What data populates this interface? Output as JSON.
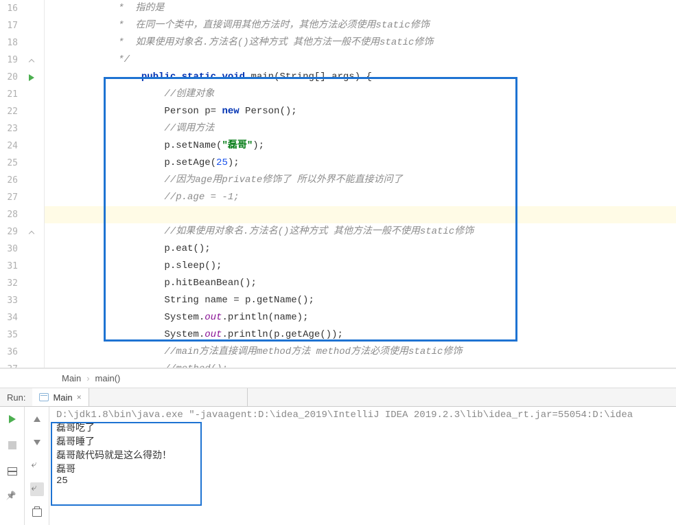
{
  "lines": [
    {
      "n": 16,
      "ind": 2,
      "type": "comment",
      "text": "*  指的是"
    },
    {
      "n": 17,
      "ind": 2,
      "type": "comment",
      "text": "*  在同一个类中，直接调用其他方法时，其他方法必须使用static修饰"
    },
    {
      "n": 18,
      "ind": 2,
      "type": "comment",
      "text": "*  如果使用对象名.方法名()这种方式 其他方法一般不使用static修饰"
    },
    {
      "n": 19,
      "ind": 2,
      "type": "comment",
      "text": "*/",
      "fold": "up"
    },
    {
      "n": 20,
      "ind": 3,
      "type": "main",
      "run": true,
      "fold": "down",
      "parts": [
        {
          "t": "public ",
          "c": "kw"
        },
        {
          "t": "static ",
          "c": "kw"
        },
        {
          "t": "void ",
          "c": "kw"
        },
        {
          "t": "main(String[] args) {"
        }
      ]
    },
    {
      "n": 21,
      "ind": 4,
      "type": "comment",
      "text": "//创建对象"
    },
    {
      "n": 22,
      "ind": 4,
      "type": "code",
      "parts": [
        {
          "t": "Person p= "
        },
        {
          "t": "new ",
          "c": "kw2"
        },
        {
          "t": "Person();"
        }
      ]
    },
    {
      "n": 23,
      "ind": 4,
      "type": "comment",
      "text": "//调用方法"
    },
    {
      "n": 24,
      "ind": 4,
      "type": "code",
      "parts": [
        {
          "t": "p.setName("
        },
        {
          "t": "\"磊哥\"",
          "c": "str"
        },
        {
          "t": ");"
        }
      ]
    },
    {
      "n": 25,
      "ind": 4,
      "type": "code",
      "parts": [
        {
          "t": "p.setAge("
        },
        {
          "t": "25",
          "c": "num"
        },
        {
          "t": ");"
        }
      ]
    },
    {
      "n": 26,
      "ind": 4,
      "type": "comment",
      "text": "//因为age用private修饰了 所以外界不能直接访问了"
    },
    {
      "n": 27,
      "ind": 4,
      "type": "comment",
      "text": "//p.age = -1;"
    },
    {
      "n": 28,
      "ind": 4,
      "type": "empty",
      "hl": true
    },
    {
      "n": 29,
      "ind": 4,
      "type": "comment",
      "text": "//如果使用对象名.方法名()这种方式 其他方法一般不使用static修饰",
      "fold": "up"
    },
    {
      "n": 30,
      "ind": 4,
      "type": "code",
      "parts": [
        {
          "t": "p.eat();"
        }
      ]
    },
    {
      "n": 31,
      "ind": 4,
      "type": "code",
      "parts": [
        {
          "t": "p.sleep();"
        }
      ]
    },
    {
      "n": 32,
      "ind": 4,
      "type": "code",
      "parts": [
        {
          "t": "p.hitBeanBean();"
        }
      ]
    },
    {
      "n": 33,
      "ind": 4,
      "type": "code",
      "parts": [
        {
          "t": "String name = p.getName();"
        }
      ]
    },
    {
      "n": 34,
      "ind": 4,
      "type": "code",
      "parts": [
        {
          "t": "System."
        },
        {
          "t": "out",
          "c": "field"
        },
        {
          "t": ".println(name);"
        }
      ]
    },
    {
      "n": 35,
      "ind": 4,
      "type": "code",
      "parts": [
        {
          "t": "System."
        },
        {
          "t": "out",
          "c": "field"
        },
        {
          "t": ".println(p.getAge());"
        }
      ]
    },
    {
      "n": 36,
      "ind": 4,
      "type": "comment",
      "text": "//main方法直接调用method方法 method方法必须使用static修饰"
    },
    {
      "n": 37,
      "ind": 4,
      "type": "comment",
      "text": "//method();"
    }
  ],
  "breadcrumb": {
    "items": [
      "Main",
      "main()"
    ]
  },
  "run": {
    "panel_label": "Run:",
    "tab_name": "Main",
    "cmdline": "D:\\jdk1.8\\bin\\java.exe \"-javaagent:D:\\idea_2019\\IntelliJ IDEA 2019.2.3\\lib\\idea_rt.jar=55054:D:\\idea",
    "output": [
      "磊哥吃了",
      "磊哥睡了",
      "磊哥敲代码就是这么得劲！",
      "磊哥",
      "25"
    ]
  }
}
